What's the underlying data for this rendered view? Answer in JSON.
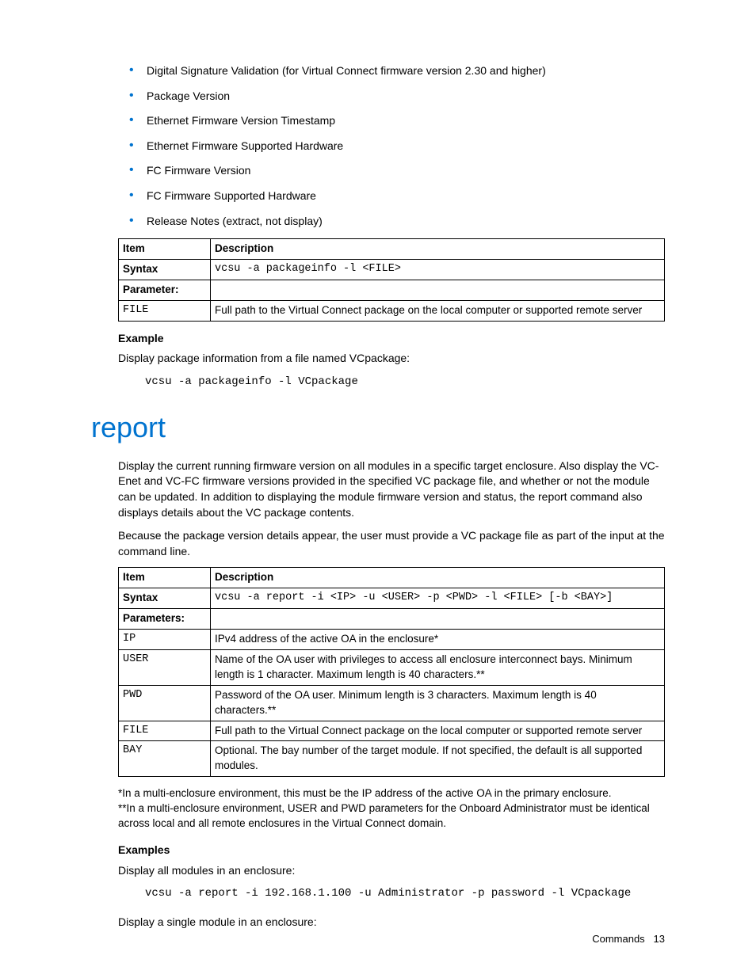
{
  "bullets": [
    "Digital Signature Validation (for Virtual Connect firmware version 2.30 and higher)",
    "Package Version",
    "Ethernet Firmware Version Timestamp",
    "Ethernet Firmware Supported Hardware",
    "FC Firmware Version",
    "FC Firmware Supported Hardware",
    "Release Notes (extract, not display)"
  ],
  "table1": {
    "h_item": "Item",
    "h_desc": "Description",
    "syntax_label": "Syntax",
    "syntax_value": "vcsu -a packageinfo -l <FILE>",
    "param_label": "Parameter:",
    "rows": [
      {
        "k": "FILE",
        "v": "Full path to the Virtual Connect package on the local computer or supported remote server"
      }
    ]
  },
  "example_label": "Example",
  "example_intro": "Display package information from a file named VCpackage:",
  "example_code": "vcsu -a packageinfo -l VCpackage",
  "heading": "report",
  "report_para1": "Display the current running firmware version on all modules in a specific target enclosure. Also display the VC-Enet and VC-FC firmware versions provided in the specified VC package file, and whether or not the module can be updated. In addition to displaying the module firmware version and status, the report command also displays details about the VC package contents.",
  "report_para2": "Because the package version details appear, the user must provide a VC package file as part of the input at the command line.",
  "table2": {
    "h_item": "Item",
    "h_desc": "Description",
    "syntax_label": "Syntax",
    "syntax_value": "vcsu -a report -i <IP> -u <USER> -p <PWD> -l <FILE> [-b <BAY>]",
    "param_label": "Parameters:",
    "rows": [
      {
        "k": "IP",
        "v": "IPv4 address of the active OA in the enclosure*"
      },
      {
        "k": "USER",
        "v": "Name of the OA user with privileges to access all enclosure interconnect bays. Minimum length is 1 character. Maximum length is 40 characters.**"
      },
      {
        "k": "PWD",
        "v": "Password of the OA user. Minimum length is 3 characters. Maximum length is 40 characters.**"
      },
      {
        "k": "FILE",
        "v": "Full path to the Virtual Connect package on the local computer or supported remote server"
      },
      {
        "k": "BAY",
        "v": "Optional. The bay number of the target module. If not specified, the default is all supported modules."
      }
    ]
  },
  "footnote1": "*In a multi-enclosure environment, this must be the IP address of the active OA in the primary enclosure.",
  "footnote2": "**In a multi-enclosure environment, USER and PWD parameters for the Onboard Administrator must be identical across local and all remote enclosures in the Virtual Connect domain.",
  "examples_label": "Examples",
  "ex2_intro": "Display all modules in an enclosure:",
  "ex2_code": "vcsu -a report -i 192.168.1.100 -u Administrator -p password -l VCpackage",
  "ex3_intro": "Display a single module in an enclosure:",
  "footer_label": "Commands",
  "footer_page": "13"
}
